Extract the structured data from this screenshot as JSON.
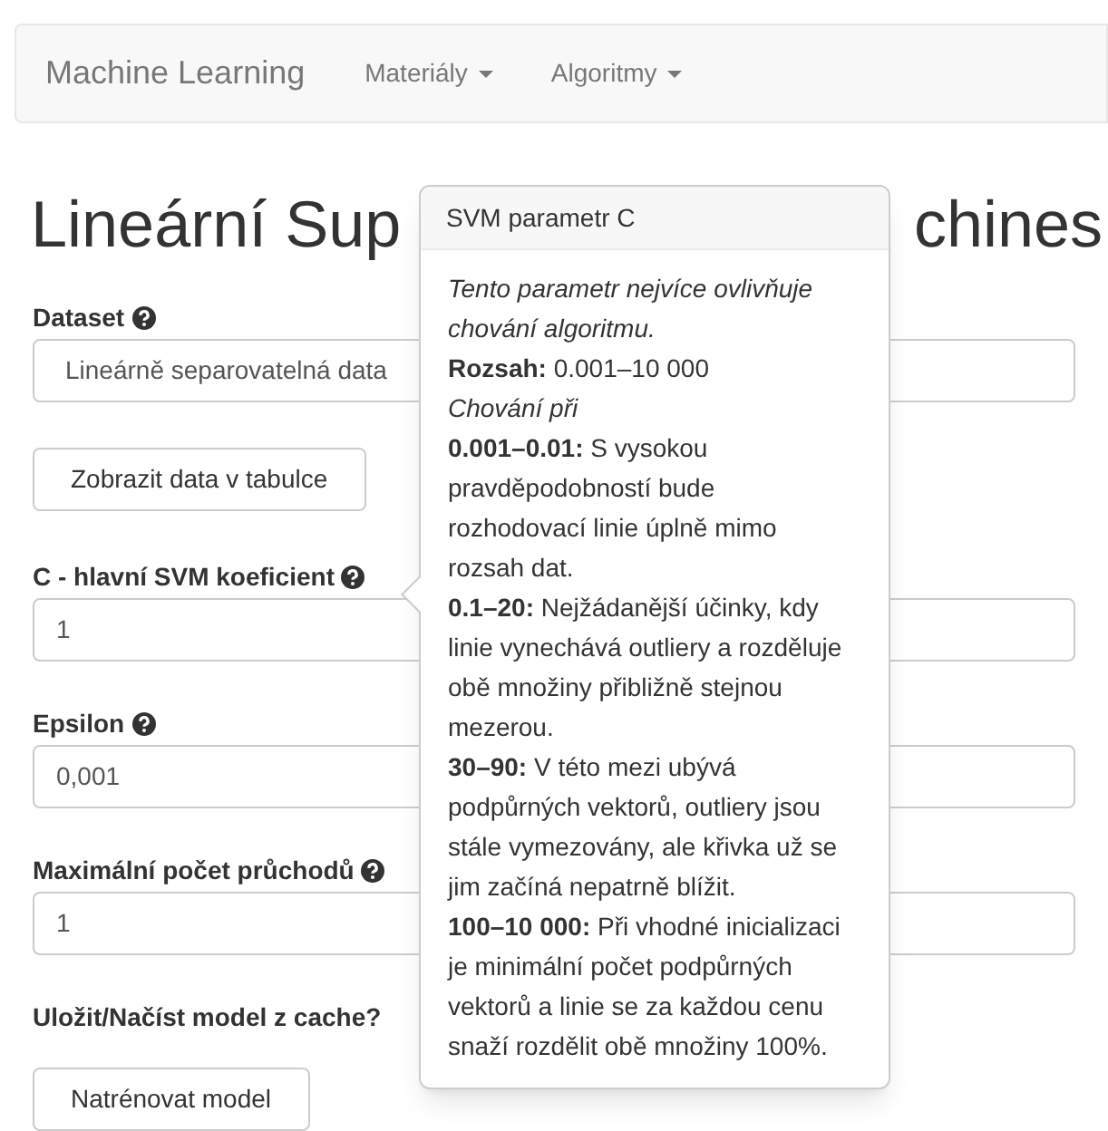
{
  "navbar": {
    "brand": "Machine Learning",
    "menus": [
      {
        "label": "Materiály"
      },
      {
        "label": "Algoritmy"
      }
    ]
  },
  "heading": {
    "visible_left": "Lineární Sup",
    "visible_right": "chines"
  },
  "form": {
    "fields": [
      {
        "kind": "select",
        "label": "Dataset",
        "help": true,
        "value": "Lineárně separovatelná data"
      },
      {
        "kind": "button",
        "label": "Zobrazit data v tabulce"
      },
      {
        "kind": "input",
        "label": "C - hlavní SVM koeficient",
        "help": true,
        "value": "1"
      },
      {
        "kind": "input",
        "label": "Epsilon",
        "help": true,
        "value": "0,001"
      },
      {
        "kind": "input",
        "label": "Maximální počet průchodů",
        "help": true,
        "value": "1"
      },
      {
        "kind": "text",
        "label": "Uložit/Načíst model z cache?"
      },
      {
        "kind": "button",
        "label": "Natrénovat model"
      }
    ]
  },
  "popover": {
    "title": "SVM parametr C",
    "paragraphs": [
      {
        "kind": "italic",
        "text": "Tento parametr nejvíce ovlivňuje chování algoritmu."
      },
      {
        "kind": "plain",
        "text": "**Rozsah:** 0.001–10 000"
      },
      {
        "kind": "italic",
        "text": "Chování při"
      },
      {
        "kind": "plain",
        "text": "**0.001–0.01:** S vysokou pravděpodobností bude rozhodovací linie úplně mimo rozsah dat."
      },
      {
        "kind": "plain",
        "text": "**0.1–20:** Nejžádanější účinky, kdy linie vynechává outliery a rozděluje obě množiny přibližně stejnou mezerou."
      },
      {
        "kind": "plain",
        "text": "**30–90:** V této mezi ubývá podpůrných vektorů, outliery jsou stále vymezovány, ale křivka už se jim začíná nepatrně blížit."
      },
      {
        "kind": "plain",
        "text": "**100–10 000:** Při vhodné inicializaci je minimální počet podpůrných vektorů a linie se za každou cenu snaží rozdělit obě množiny 100%."
      }
    ]
  }
}
